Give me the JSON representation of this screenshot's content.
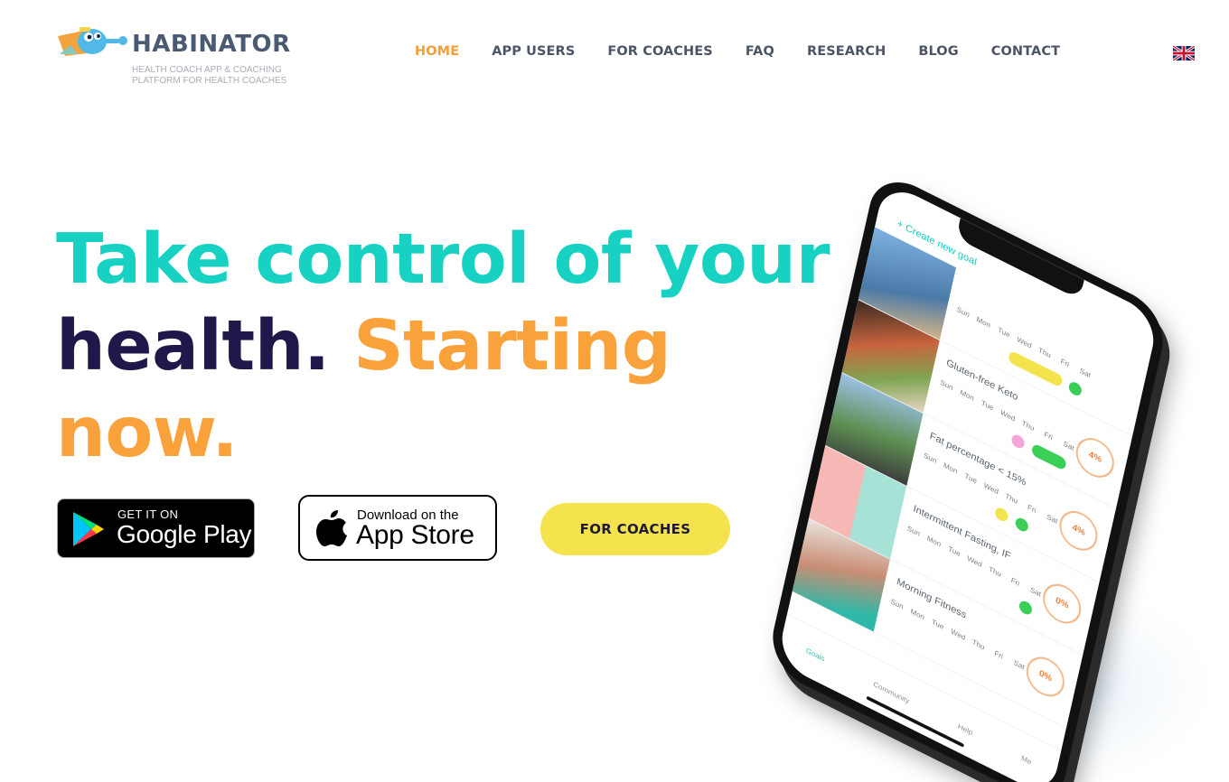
{
  "brand": {
    "name": "HABINATOR",
    "tagline": "HEALTH COACH APP & COACHING PLATFORM FOR HEALTH COACHES"
  },
  "nav": {
    "items": [
      {
        "label": "HOME",
        "active": true
      },
      {
        "label": "APP USERS",
        "active": false
      },
      {
        "label": "FOR COACHES",
        "active": false
      },
      {
        "label": "FAQ",
        "active": false
      },
      {
        "label": "RESEARCH",
        "active": false
      },
      {
        "label": "BLOG",
        "active": false
      },
      {
        "label": "CONTACT",
        "active": false
      }
    ],
    "language_icon": "uk-flag-icon"
  },
  "hero": {
    "title_line1": "Take control of your",
    "title_line2a": "health.",
    "title_line2b": "Starting",
    "title_line3": "now."
  },
  "badges": {
    "google_small": "GET IT ON",
    "google_big": "Google Play",
    "apple_small": "Download on the",
    "apple_big": "App Store"
  },
  "cta": {
    "label": "FOR COACHES"
  },
  "phone": {
    "create_goal": "+ Create new goal",
    "goals": [
      {
        "name": "",
        "ring": "",
        "tone": "#6d9ac7"
      },
      {
        "name": "Gluten-free Keto",
        "ring": "4%",
        "tone": "#b5553a"
      },
      {
        "name": "Fat percentage < 15%",
        "ring": "4%",
        "tone": "#5f8e4c"
      },
      {
        "name": "Intermittent Fasting, IF",
        "ring": "0%",
        "tone": "#9bdccd"
      },
      {
        "name": "Morning Fitness",
        "ring": "0%",
        "tone": "#c98d74"
      }
    ],
    "weekdays": [
      "Sun",
      "Mon",
      "Tue",
      "Wed",
      "Thu",
      "Fri",
      "Sat"
    ],
    "tabs": [
      "Goals",
      "Community",
      "Help",
      "Me"
    ],
    "colors": {
      "accent": "#17c9bd",
      "progress": "#f0823a",
      "done": "#3bcf5a",
      "highlight": "#f4e34c",
      "missed": "#f3a6d8"
    }
  },
  "colors": {
    "teal": "#17d2c2",
    "navy": "#22174a",
    "orange": "#f9a23c",
    "nav_active": "#f29e38",
    "nav_text": "#4b5566",
    "cta_yellow": "#f4e34c"
  }
}
